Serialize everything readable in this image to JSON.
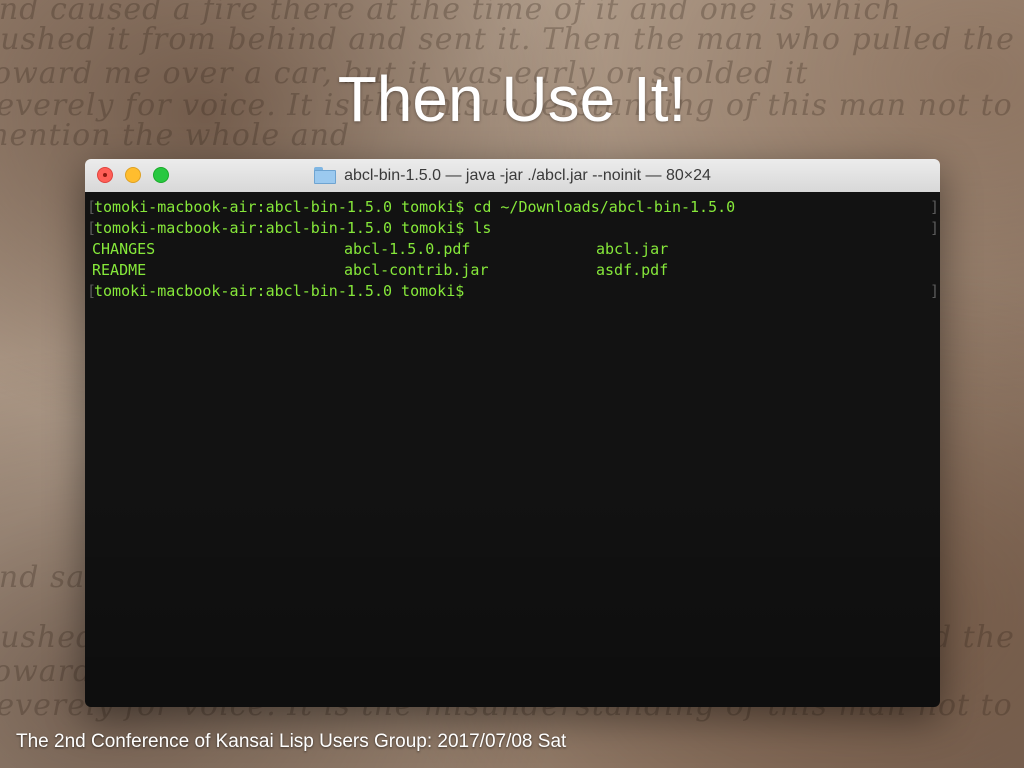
{
  "slide": {
    "title": "Then Use It!",
    "footer": "The 2nd Conference of Kansai Lisp Users Group: 2017/07/08 Sat"
  },
  "window": {
    "title": "abcl-bin-1.5.0 — java -jar ./abcl.jar --noinit — 80×24",
    "icon": "folder-icon",
    "colors": {
      "text": "#86e83a",
      "background": "#121212",
      "close": "#ff5f57",
      "minimize": "#ffbd2e",
      "zoom": "#28c840"
    }
  },
  "terminal": {
    "lines": [
      "tomoki-macbook-air:abcl-bin-1.5.0 tomoki$ cd ~/Downloads/abcl-bin-1.5.0",
      "tomoki-macbook-air:abcl-bin-1.5.0 tomoki$ ls"
    ],
    "ls_output": [
      [
        "CHANGES",
        "abcl-1.5.0.pdf",
        "abcl.jar"
      ],
      [
        "README",
        "abcl-contrib.jar",
        "asdf.pdf"
      ]
    ],
    "prompt": "tomoki-macbook-air:abcl-bin-1.5.0 tomoki$",
    "bracket_left": "[",
    "bracket_right": "]"
  }
}
